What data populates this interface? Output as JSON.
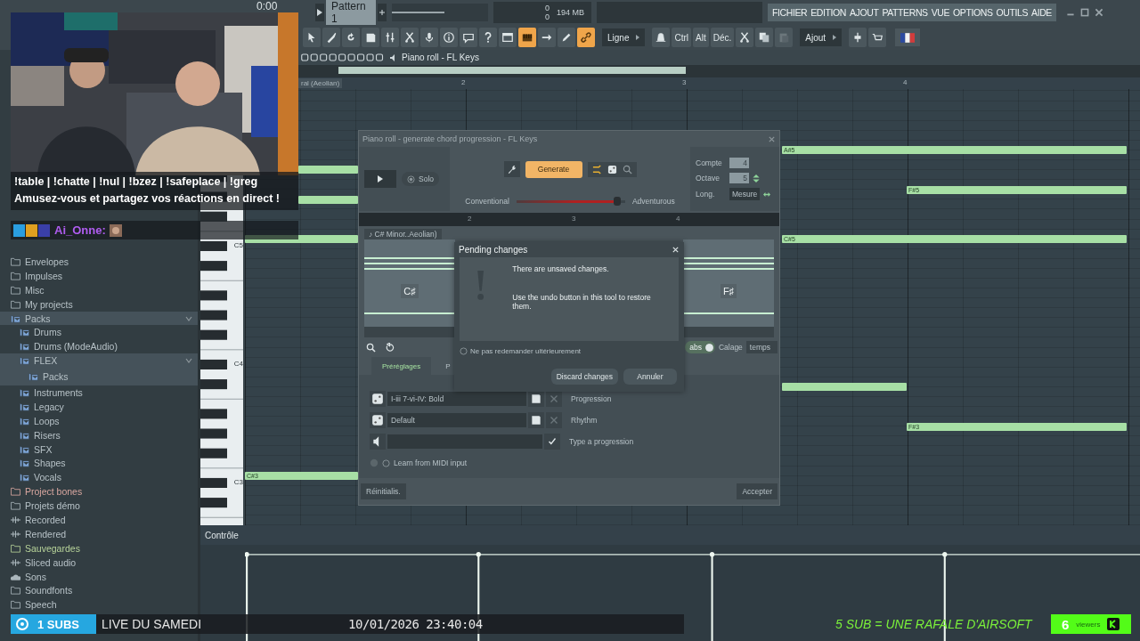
{
  "transport": {
    "time": "0:00",
    "pattern": "Pattern 1",
    "master_slider": {
      "level": 0.55
    },
    "cpu": "0",
    "memory": "194 MB",
    "polyphony": "0"
  },
  "menu": [
    "FICHIER",
    "EDITION",
    "AJOUT",
    "PATTERNS",
    "VUE",
    "OPTIONS",
    "OUTILS",
    "AIDE"
  ],
  "toolbar": [
    {
      "kind": "icon",
      "on": false
    },
    {
      "kind": "icon",
      "on": false
    },
    {
      "kind": "icon",
      "on": false
    },
    {
      "kind": "icon",
      "on": false
    },
    {
      "kind": "icon",
      "on": false
    },
    {
      "kind": "icon",
      "on": false
    },
    {
      "kind": "icon",
      "on": false
    },
    {
      "kind": "icon",
      "on": false
    },
    {
      "kind": "icon",
      "on": false
    },
    {
      "kind": "icon",
      "on": false
    },
    {
      "kind": "icon",
      "on": false
    },
    {
      "kind": "icon",
      "on": true
    },
    {
      "kind": "icon",
      "on": false
    },
    {
      "kind": "icon",
      "on": false
    },
    {
      "kind": "icon",
      "on": true
    },
    {
      "kind": "dropdown",
      "label": "Ligne"
    },
    {
      "kind": "icon",
      "on": false
    },
    {
      "kind": "text",
      "label": "Ctrl"
    },
    {
      "kind": "text",
      "label": "Alt"
    },
    {
      "kind": "text",
      "label": "Déc."
    },
    {
      "kind": "icon",
      "on": false
    },
    {
      "kind": "icon",
      "on": false
    },
    {
      "kind": "icon",
      "on": false
    },
    {
      "kind": "dropdown",
      "label": "Ajout"
    },
    {
      "kind": "icon",
      "on": false
    },
    {
      "kind": "icon",
      "on": false
    },
    {
      "kind": "flag"
    }
  ],
  "browser": {
    "items": [
      {
        "label": "Envelopes",
        "kind": "folder"
      },
      {
        "label": "Impulses",
        "kind": "folder"
      },
      {
        "label": "Misc",
        "kind": "folder"
      },
      {
        "label": "My projects",
        "kind": "folder"
      },
      {
        "label": "Packs",
        "kind": "pack",
        "expanded": true,
        "selected": false,
        "children": [
          {
            "label": "Drums",
            "kind": "pack",
            "selected": false
          },
          {
            "label": "Drums (ModeAudio)",
            "kind": "pack",
            "selected": false
          },
          {
            "label": "FLEX",
            "kind": "pack",
            "expanded": true,
            "selected": false,
            "children": [
              {
                "label": "Packs",
                "kind": "pack",
                "selected": true
              }
            ]
          },
          {
            "label": "Instruments",
            "kind": "pack",
            "selected": false
          },
          {
            "label": "Legacy",
            "kind": "pack",
            "selected": false
          },
          {
            "label": "Loops",
            "kind": "pack",
            "selected": false
          },
          {
            "label": "Risers",
            "kind": "pack",
            "selected": false
          },
          {
            "label": "SFX",
            "kind": "pack",
            "selected": false
          },
          {
            "label": "Shapes",
            "kind": "pack",
            "selected": false
          },
          {
            "label": "Vocals",
            "kind": "pack",
            "selected": false
          }
        ]
      },
      {
        "label": "Project bones",
        "kind": "folder",
        "color": "#d9a7a0"
      },
      {
        "label": "Projets démo",
        "kind": "folder"
      },
      {
        "label": "Recorded",
        "kind": "audio"
      },
      {
        "label": "Rendered",
        "kind": "audio"
      },
      {
        "label": "Sauvegardes",
        "kind": "folder",
        "color": "#b8d49a"
      },
      {
        "label": "Sliced audio",
        "kind": "audio"
      },
      {
        "label": "Sons",
        "kind": "cloud"
      },
      {
        "label": "Soundfonts",
        "kind": "folder"
      },
      {
        "label": "Speech",
        "kind": "folder"
      }
    ]
  },
  "piano_roll": {
    "title": "Piano roll - FL Keys",
    "scale_label": "ral (Aeolian)",
    "bars": [
      "2",
      "3",
      "4"
    ],
    "key_labels": [
      "C5",
      "C4",
      "C3"
    ],
    "notes": [
      {
        "label": "A#5"
      },
      {
        "label": "F#5"
      },
      {
        "label": "C#5"
      },
      {
        "label": "F#3"
      },
      {
        "label": "C#3"
      }
    ],
    "control_label": "Contrôle"
  },
  "chord_dialog": {
    "title": "Piano roll - generate chord progression - FL Keys",
    "solo": "Solo",
    "generate": "Generate",
    "slider": {
      "left": "Conventional",
      "right": "Adventurous",
      "level": 0.93
    },
    "compte": {
      "label": "Compte",
      "value": "4"
    },
    "octave": {
      "label": "Octave",
      "value": "5"
    },
    "length": {
      "label": "Long.",
      "value": "Mesure"
    },
    "bars": [
      "2",
      "3",
      "4"
    ],
    "scale": "♪ C# Minor..Aeolian)",
    "chords": [
      "C♯",
      "F♯"
    ],
    "abs": {
      "label": "abs",
      "on": true
    },
    "snap": {
      "label": "Calage",
      "value": "temps"
    },
    "tabs": [
      {
        "label": "Préréglages",
        "selected": true
      },
      {
        "label": "P",
        "selected": false
      }
    ],
    "rows": [
      {
        "kind": "preset",
        "value": "I-iii 7-vi-IV: Bold",
        "label": "Progression"
      },
      {
        "kind": "preset",
        "value": "Default",
        "label": "Rhythm"
      },
      {
        "kind": "input",
        "label": "Type a progression"
      }
    ],
    "learn": "Learn from MIDI input",
    "reset": "Réinitialis.",
    "accept": "Accepter"
  },
  "pending_dialog": {
    "title": "Pending changes",
    "lines": [
      "There are unsaved changes.",
      "Use the undo button in this tool to restore them."
    ],
    "dont_ask": {
      "label": "Ne pas redemander ultérieurement",
      "checked": false
    },
    "buttons": [
      "Discard changes",
      "Annuler"
    ]
  },
  "stream_overlay": {
    "chat_message": "!table | !chatte | !nul | !bzez | !safeplace | !greg Amusez-vous et partagez vos réactions en direct !",
    "chat_user": "Ai_Onne:",
    "subs": "1 SUBS",
    "show_title": "LIVE DU SAMEDI",
    "datetime": "10/01/2026 23:40:04",
    "goal": "5 SUB = UNE RAFALE D'AIRSOFT",
    "viewers": "6",
    "viewers_label": "viewers"
  }
}
